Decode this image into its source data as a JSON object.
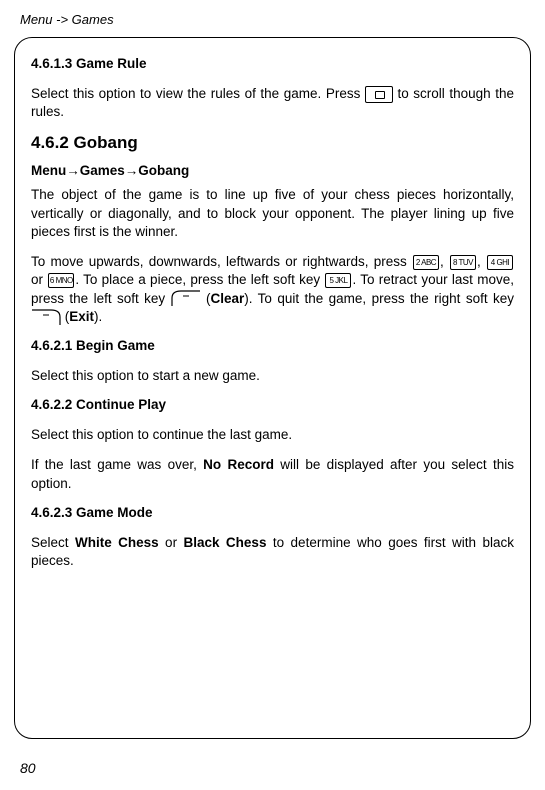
{
  "header": "Menu -> Games",
  "s1": {
    "heading": "4.6.1.3 Game Rule",
    "p1a": "Select this option to view the rules of the game. Press ",
    "p1b": " to scroll though the rules."
  },
  "s2": {
    "heading": "4.6.2 Gobang",
    "breadcrumb": {
      "a": "Menu",
      "b": "Games",
      "c": "Gobang"
    },
    "p1": "The object of the game is to line up five of your chess pieces horizontally, vertically or diagonally, and to block your opponent. The player lining up five pieces first is the winner.",
    "p2a": "To move upwards, downwards, leftwards or rightwards, press ",
    "p2b": ", ",
    "p2c": ", ",
    "p2d": " or ",
    "p2e": ". To place a piece, press the left soft key ",
    "p2f": ". To retract your last move, press the left soft key ",
    "p2g": " (",
    "p2h": "Clear",
    "p2i": "). To quit the game, press the right soft key ",
    "p2j": " (",
    "p2k": "Exit",
    "p2l": ")."
  },
  "s3": {
    "heading": "4.6.2.1 Begin Game",
    "p1": "Select this option to start a new game."
  },
  "s4": {
    "heading": "4.6.2.2 Continue Play",
    "p1": "Select this option to continue the last game.",
    "p2a": "If the last game was over, ",
    "p2b": "No Record",
    "p2c": " will be displayed after you select this option."
  },
  "s5": {
    "heading": "4.6.2.3 Game Mode",
    "p1a": "Select ",
    "p1b": "White Chess",
    "p1c": " or ",
    "p1d": "Black Chess",
    "p1e": " to determine who goes first with black pieces."
  },
  "keys": {
    "k2": "2 ABC",
    "k8": "8 TUV",
    "k4": "4 GHI",
    "k6": "6 MNO",
    "k5": "5 JKL"
  },
  "pageNumber": "80"
}
